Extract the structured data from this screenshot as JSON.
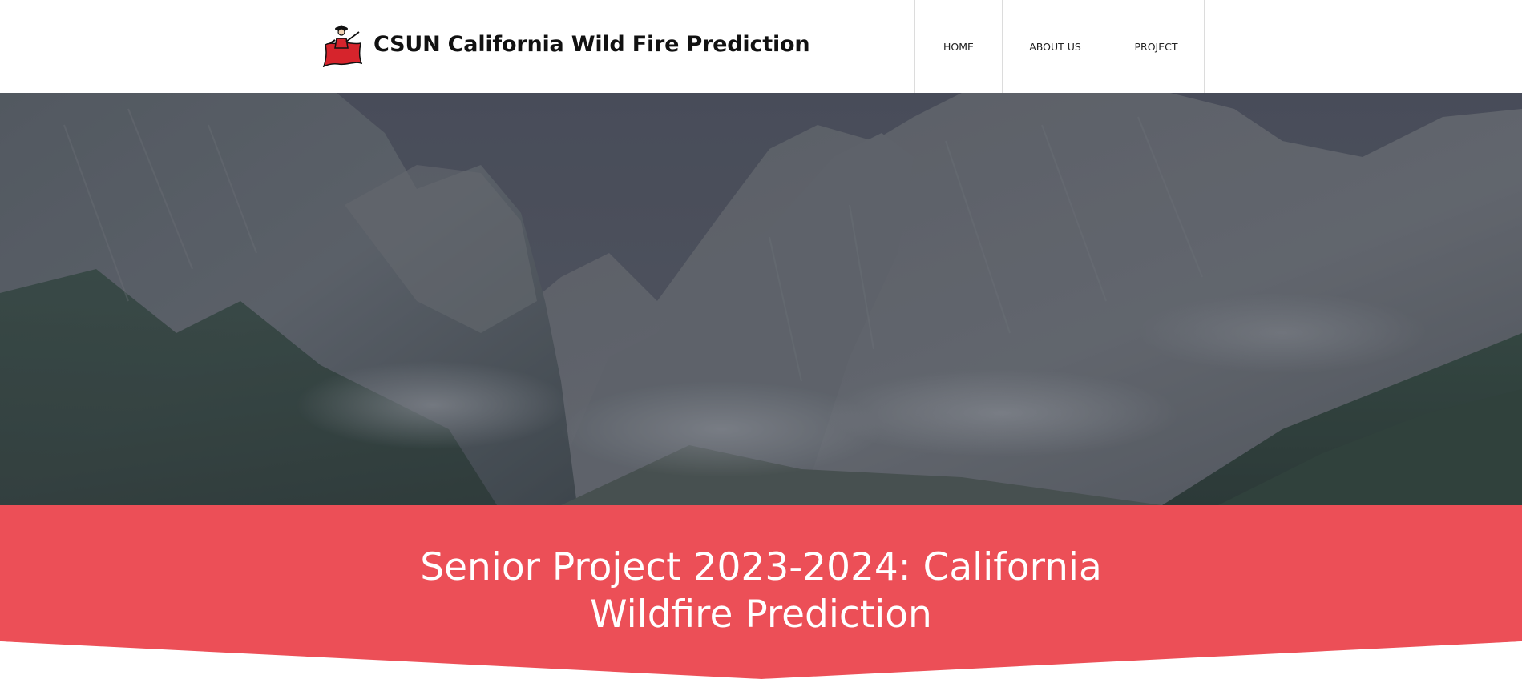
{
  "header": {
    "brand_title": "CSUN California Wild Fire Prediction",
    "logo_icon": "matador-logo-icon",
    "nav": [
      {
        "label": "HOME"
      },
      {
        "label": "ABOUT US"
      },
      {
        "label": "PROJECT"
      }
    ]
  },
  "hero": {
    "image": "mountain-valley-landscape"
  },
  "banner": {
    "title": "Senior Project 2023-2024: California Wildfire Prediction",
    "background_color": "#ec4f57"
  },
  "colors": {
    "accent": "#ec4f57",
    "header_bg": "#ffffff",
    "text_dark": "#111111"
  }
}
